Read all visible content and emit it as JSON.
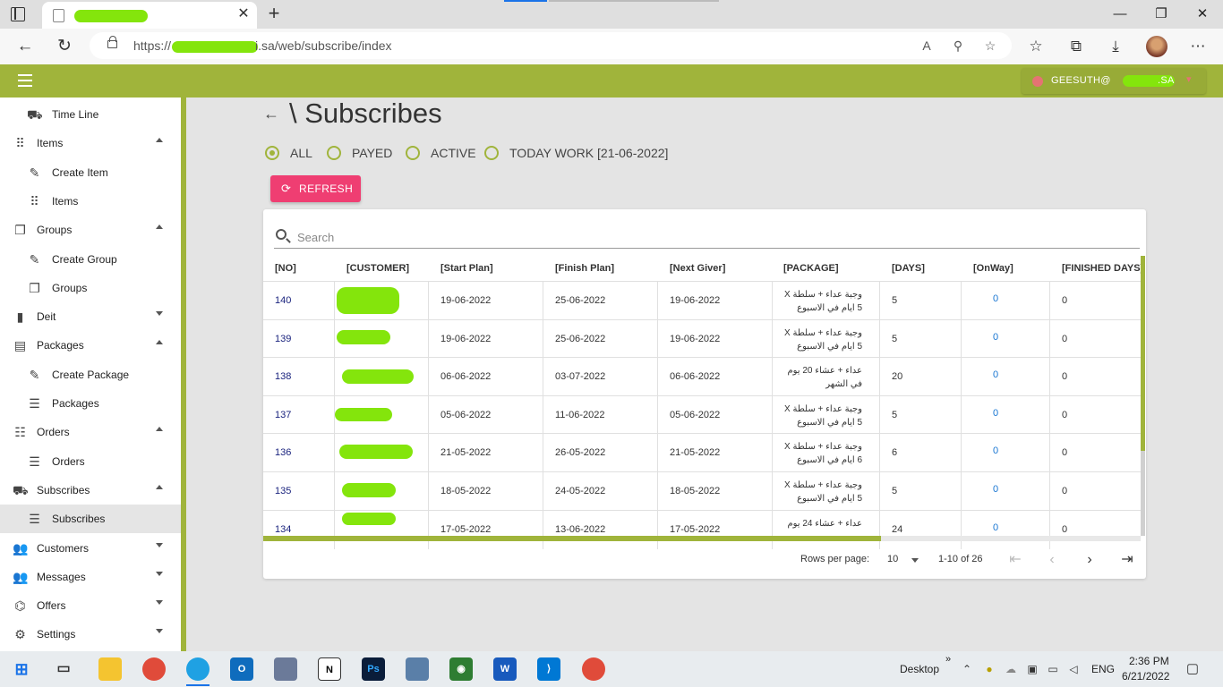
{
  "browser": {
    "url": "https://",
    "url_suffix": "i.sa/web/subscribe/index",
    "window_controls": [
      "—",
      "❐",
      "✕"
    ]
  },
  "app": {
    "user": "GEESUTH@",
    "user_suffix": ".SA"
  },
  "sidebar": {
    "items": [
      {
        "label": "Time Line",
        "icon": "timeline-icon",
        "indent": true,
        "arrow": ""
      },
      {
        "label": "Items",
        "icon": "grid-icon",
        "indent": false,
        "arrow": "up"
      },
      {
        "label": "Create Item",
        "icon": "pencil-icon",
        "indent": true,
        "arrow": ""
      },
      {
        "label": "Items",
        "icon": "grid-icon",
        "indent": true,
        "arrow": ""
      },
      {
        "label": "Groups",
        "icon": "copy-icon",
        "indent": false,
        "arrow": "up"
      },
      {
        "label": "Create Group",
        "icon": "pencil-icon",
        "indent": true,
        "arrow": ""
      },
      {
        "label": "Groups",
        "icon": "copy-icon",
        "indent": true,
        "arrow": ""
      },
      {
        "label": "Deit",
        "icon": "bar-chart-icon",
        "indent": false,
        "arrow": "down"
      },
      {
        "label": "Packages",
        "icon": "calendar-icon",
        "indent": false,
        "arrow": "up"
      },
      {
        "label": "Create Package",
        "icon": "pencil-icon",
        "indent": true,
        "arrow": ""
      },
      {
        "label": "Packages",
        "icon": "list-icon",
        "indent": true,
        "arrow": ""
      },
      {
        "label": "Orders",
        "icon": "orders-icon",
        "indent": false,
        "arrow": "up"
      },
      {
        "label": "Orders",
        "icon": "list-icon",
        "indent": true,
        "arrow": ""
      },
      {
        "label": "Subscribes",
        "icon": "delivery-icon",
        "indent": false,
        "arrow": "up"
      },
      {
        "label": "Subscribes",
        "icon": "list-icon",
        "indent": true,
        "arrow": "",
        "active": true
      },
      {
        "label": "Customers",
        "icon": "people-icon",
        "indent": false,
        "arrow": "down"
      },
      {
        "label": "Messages",
        "icon": "people-icon",
        "indent": false,
        "arrow": "down"
      },
      {
        "label": "Offers",
        "icon": "offers-icon",
        "indent": false,
        "arrow": "down"
      },
      {
        "label": "Settings",
        "icon": "gear-icon",
        "indent": false,
        "arrow": "down"
      }
    ]
  },
  "page": {
    "title": "\\ Subscribes",
    "filters": [
      {
        "label": "ALL",
        "checked": true
      },
      {
        "label": "PAYED",
        "checked": false
      },
      {
        "label": "ACTIVE",
        "checked": false
      },
      {
        "label": "TODAY WORK [21-06-2022]",
        "checked": false
      }
    ],
    "refresh_label": "REFRESH",
    "search_placeholder": "Search"
  },
  "table": {
    "columns": [
      "[NO]",
      "[CUSTOMER]",
      "[Start Plan]",
      "[Finish Plan]",
      "[Next Giver]",
      "[PACKAGE]",
      "[DAYS]",
      "[OnWay]",
      "[FINISHED DAYS]"
    ],
    "rows": [
      {
        "no": "140",
        "start": "19-06-2022",
        "finish": "25-06-2022",
        "next": "19-06-2022",
        "package": "وجبة عداء + سلطة X 5 ايام في الاسبوع",
        "days": "5",
        "onway": "0",
        "finished": "0"
      },
      {
        "no": "139",
        "start": "19-06-2022",
        "finish": "25-06-2022",
        "next": "19-06-2022",
        "package": "وجبة عداء + سلطة X 5 ايام في الاسبوع",
        "days": "5",
        "onway": "0",
        "finished": "0"
      },
      {
        "no": "138",
        "start": "06-06-2022",
        "finish": "03-07-2022",
        "next": "06-06-2022",
        "package": "عداء + عشاء 20 يوم في الشهر",
        "days": "20",
        "onway": "0",
        "finished": "0"
      },
      {
        "no": "137",
        "start": "05-06-2022",
        "finish": "11-06-2022",
        "next": "05-06-2022",
        "package": "وجبة عداء + سلطة X 5 ايام في الاسبوع",
        "days": "5",
        "onway": "0",
        "finished": "0"
      },
      {
        "no": "136",
        "start": "21-05-2022",
        "finish": "26-05-2022",
        "next": "21-05-2022",
        "package": "وجبة عداء + سلطة X 6 ايام في الاسبوع",
        "days": "6",
        "onway": "0",
        "finished": "0"
      },
      {
        "no": "135",
        "start": "18-05-2022",
        "finish": "24-05-2022",
        "next": "18-05-2022",
        "package": "وجبة عداء + سلطة X 5 ايام في الاسبوع",
        "days": "5",
        "onway": "0",
        "finished": "0"
      },
      {
        "no": "134",
        "start": "17-05-2022",
        "finish": "13-06-2022",
        "next": "17-05-2022",
        "package": "عداء + عشاء 24 يوم",
        "days": "24",
        "onway": "0",
        "finished": "0"
      }
    ]
  },
  "pagination": {
    "rows_per_page_label": "Rows per page:",
    "rows_per_page": "10",
    "range": "1-10 of 26"
  },
  "taskbar": {
    "desktop_label": "Desktop",
    "language": "ENG",
    "time": "2:36 PM",
    "date": "6/21/2022",
    "chevron": "»"
  }
}
